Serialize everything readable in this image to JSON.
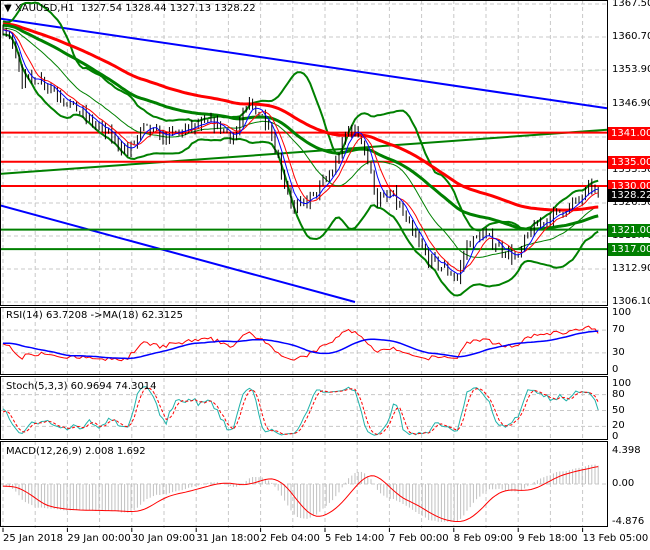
{
  "header": {
    "symbol": "XAUUSD,H1",
    "ohlc": "1327.54 1328.44 1327.13 1328.22"
  },
  "price_axis": [
    "1367.50",
    "1360.70",
    "1353.90",
    "1346.90",
    "1340.10",
    "1333.30",
    "1326.50",
    "1319.70",
    "1312.90",
    "1306.10"
  ],
  "price_range": [
    1306.1,
    1367.5
  ],
  "levels": [
    {
      "price": 1341.0,
      "label": "1341.00",
      "color": "#ff0000"
    },
    {
      "price": 1335.0,
      "label": "1335.00",
      "color": "#ff0000"
    },
    {
      "price": 1330.0,
      "label": "1330.00",
      "color": "#ff0000"
    },
    {
      "price": 1321.0,
      "label": "1321.00",
      "color": "#008000"
    },
    {
      "price": 1317.0,
      "label": "1317.00",
      "color": "#008000"
    }
  ],
  "current_price": {
    "price": 1328.22,
    "label": "1328.22",
    "color": "#000000"
  },
  "rsi": {
    "label": "RSI(14) 63.7208  ->MA(18) 62.3125",
    "axis": [
      "100",
      "70",
      "30",
      "0"
    ]
  },
  "stoch": {
    "label": "Stoch(5,3,3) 60.9694 74.3014",
    "axis": [
      "100",
      "80",
      "50",
      "20",
      "0"
    ]
  },
  "macd": {
    "label": "MACD(12,26,9) 2.008 1.692",
    "axis": [
      "4.398",
      "0.00",
      "-4.876"
    ],
    "range": [
      -4.876,
      4.398
    ]
  },
  "time_axis": [
    "25 Jan 2018",
    "29 Jan 00:00",
    "30 Jan 09:00",
    "31 Jan 18:00",
    "2 Feb 04:00",
    "5 Feb 14:00",
    "7 Feb 00:00",
    "8 Feb 09:00",
    "9 Feb 18:00",
    "13 Feb 05:00"
  ],
  "chart_data": {
    "type": "line",
    "title": "XAUUSD,H1",
    "x_unit": "bar index (H1)",
    "close_waypoints": [
      [
        0,
        1362
      ],
      [
        3,
        1360
      ],
      [
        6,
        1352
      ],
      [
        12,
        1352
      ],
      [
        19,
        1348
      ],
      [
        28,
        1343
      ],
      [
        34,
        1340
      ],
      [
        39,
        1337
      ],
      [
        44,
        1342
      ],
      [
        50,
        1340
      ],
      [
        59,
        1342
      ],
      [
        66,
        1343
      ],
      [
        72,
        1340
      ],
      [
        77,
        1347
      ],
      [
        83,
        1343
      ],
      [
        87,
        1333
      ],
      [
        91,
        1325
      ],
      [
        97,
        1328
      ],
      [
        103,
        1333
      ],
      [
        108,
        1342
      ],
      [
        112,
        1340
      ],
      [
        117,
        1327
      ],
      [
        122,
        1328
      ],
      [
        128,
        1320
      ],
      [
        133,
        1315
      ],
      [
        138,
        1313
      ],
      [
        142,
        1311
      ],
      [
        145,
        1318
      ],
      [
        150,
        1320
      ],
      [
        156,
        1317
      ],
      [
        161,
        1315
      ],
      [
        164,
        1320
      ],
      [
        169,
        1323
      ],
      [
        175,
        1325
      ],
      [
        180,
        1327
      ],
      [
        184,
        1330
      ],
      [
        186,
        1328.22
      ]
    ],
    "colors": {
      "candles": "#000000",
      "channel": "#0000ff",
      "bollinger": "#008000",
      "ma_slow": "#ff0000",
      "ma_fast": "#008000",
      "rsi": "#ff0000",
      "rsi_ma": "#0000ff",
      "stoch_main": "#20b2aa",
      "stoch_signal": "#ff0000",
      "macd_hist": "#c0c0c0",
      "macd_signal": "#ff0000"
    }
  }
}
